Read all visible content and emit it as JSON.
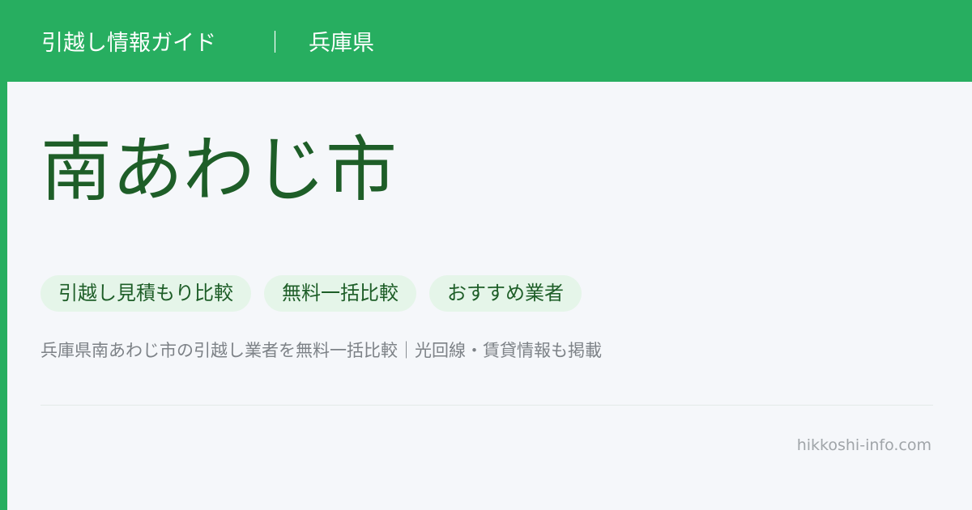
{
  "header": {
    "site_name": "引越し情報ガイド",
    "separator": "｜",
    "prefecture": "兵庫県"
  },
  "main": {
    "city": "南あわじ市",
    "tags": [
      {
        "label": "引越し見積もり比較"
      },
      {
        "label": "無料一括比較"
      },
      {
        "label": "おすすめ業者"
      }
    ],
    "description": "兵庫県南あわじ市の引越し業者を無料一括比較｜光回線・賃貸情報も掲載"
  },
  "footer": {
    "domain": "hikkoshi-info.com"
  },
  "colors": {
    "brand_green": "#27ae60",
    "title_green": "#1e5e28",
    "tag_bg": "#e5f5e9",
    "background": "#f5f7fa"
  }
}
